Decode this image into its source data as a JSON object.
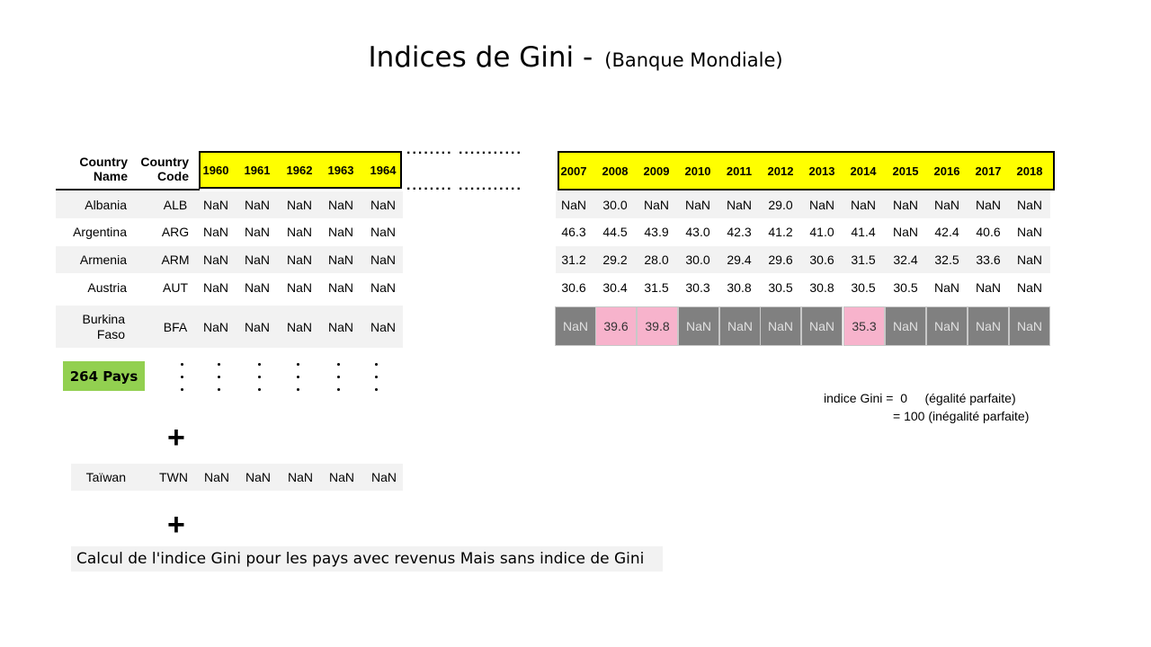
{
  "title": {
    "main": "Indices de Gini  -",
    "sub": "(Banque Mondiale)"
  },
  "header": {
    "country_name": "Country\nName",
    "country_code": "Country\nCode",
    "years_left": [
      "1960",
      "1961",
      "1962",
      "1963",
      "1964"
    ],
    "years_right": [
      "2007",
      "2008",
      "2009",
      "2010",
      "2011",
      "2012",
      "2013",
      "2014",
      "2015",
      "2016",
      "2017",
      "2018"
    ],
    "ellipsis": "........  ..........."
  },
  "rows": [
    {
      "name": "Albania",
      "code": "ALB",
      "left": [
        "NaN",
        "NaN",
        "NaN",
        "NaN",
        "NaN"
      ],
      "right": [
        "NaN",
        "30.0",
        "NaN",
        "NaN",
        "NaN",
        "29.0",
        "NaN",
        "NaN",
        "NaN",
        "NaN",
        "NaN",
        "NaN"
      ]
    },
    {
      "name": "Argentina",
      "code": "ARG",
      "left": [
        "NaN",
        "NaN",
        "NaN",
        "NaN",
        "NaN"
      ],
      "right": [
        "46.3",
        "44.5",
        "43.9",
        "43.0",
        "42.3",
        "41.2",
        "41.0",
        "41.4",
        "NaN",
        "42.4",
        "40.6",
        "NaN"
      ]
    },
    {
      "name": "Armenia",
      "code": "ARM",
      "left": [
        "NaN",
        "NaN",
        "NaN",
        "NaN",
        "NaN"
      ],
      "right": [
        "31.2",
        "29.2",
        "28.0",
        "30.0",
        "29.4",
        "29.6",
        "30.6",
        "31.5",
        "32.4",
        "32.5",
        "33.6",
        "NaN"
      ]
    },
    {
      "name": "Austria",
      "code": "AUT",
      "left": [
        "NaN",
        "NaN",
        "NaN",
        "NaN",
        "NaN"
      ],
      "right": [
        "30.6",
        "30.4",
        "31.5",
        "30.3",
        "30.8",
        "30.5",
        "30.8",
        "30.5",
        "30.5",
        "NaN",
        "NaN",
        "NaN"
      ]
    }
  ],
  "burkina": {
    "name": "Burkina\nFaso",
    "code": "BFA",
    "left": [
      "NaN",
      "NaN",
      "NaN",
      "NaN",
      "NaN"
    ],
    "right": [
      "NaN",
      "39.6",
      "39.8",
      "NaN",
      "NaN",
      "NaN",
      "NaN",
      "35.3",
      "NaN",
      "NaN",
      "NaN",
      "NaN"
    ]
  },
  "badge": "264 Pays",
  "taiwan": {
    "name": "Taïwan",
    "code": "TWN",
    "left": [
      "NaN",
      "NaN",
      "NaN",
      "NaN",
      "NaN"
    ]
  },
  "plus": "+",
  "note": {
    "line1": "indice Gini =  0     (égalité parfaite)",
    "line2": "= 100 (inégalité parfaite)"
  },
  "bottom_text": "Calcul de l'indice Gini pour  les pays avec revenus Mais sans indice de Gini",
  "colors": {
    "header_yellow": "#ffff00",
    "badge_green": "#92d050",
    "nan_gray": "#808080",
    "value_pink": "#f7b3cc",
    "row_bg": "#f2f2f2"
  }
}
